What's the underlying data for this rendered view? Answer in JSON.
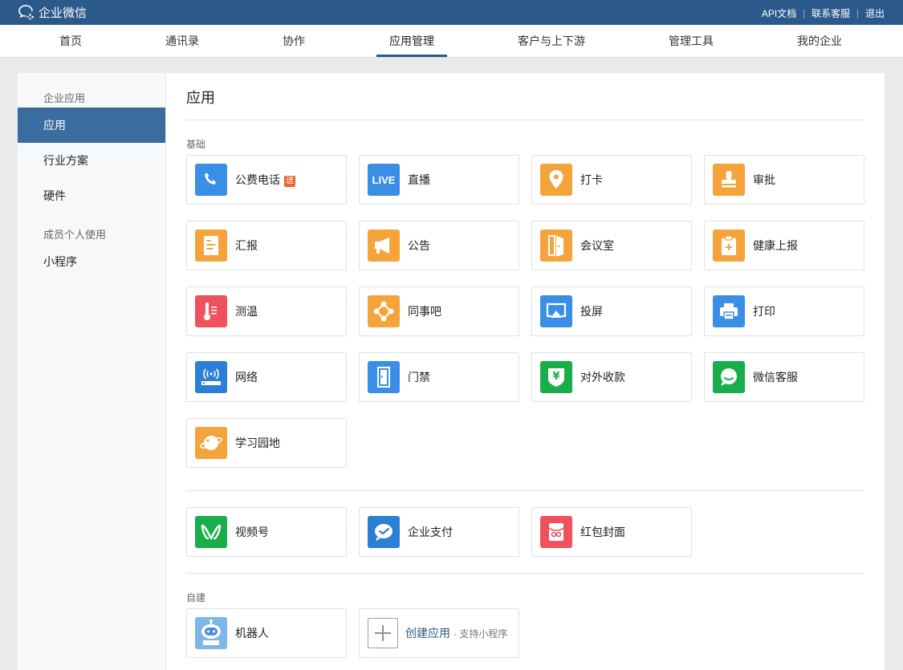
{
  "header": {
    "brand": "企业微信",
    "links": [
      "API文档",
      "联系客服",
      "退出"
    ]
  },
  "nav": {
    "items": [
      "首页",
      "通讯录",
      "协作",
      "应用管理",
      "客户与上下游",
      "管理工具",
      "我的企业"
    ],
    "active": "应用管理"
  },
  "sidebar": {
    "group1": "企业应用",
    "items1": [
      "应用",
      "行业方案",
      "硬件"
    ],
    "group2": "成员个人使用",
    "items2": [
      "小程序"
    ],
    "active": "应用"
  },
  "main": {
    "title": "应用",
    "basic_label": "基础",
    "send_badge": "送",
    "basic_apps": [
      {
        "name": "公费电话",
        "icon": "phone-icon",
        "color": "#3a8ee6"
      },
      {
        "name": "直播",
        "icon": "live-icon",
        "color": "#3a8ee6"
      },
      {
        "name": "打卡",
        "icon": "location-pin-icon",
        "color": "#f5a33b"
      },
      {
        "name": "审批",
        "icon": "stamp-icon",
        "color": "#f5a33b"
      },
      {
        "name": "汇报",
        "icon": "report-icon",
        "color": "#f5a33b"
      },
      {
        "name": "公告",
        "icon": "megaphone-icon",
        "color": "#f5a33b"
      },
      {
        "name": "会议室",
        "icon": "door-icon",
        "color": "#f5a33b"
      },
      {
        "name": "健康上报",
        "icon": "health-clipboard-icon",
        "color": "#f5a33b"
      },
      {
        "name": "测温",
        "icon": "thermometer-icon",
        "color": "#f0525d"
      },
      {
        "name": "同事吧",
        "icon": "community-icon",
        "color": "#f5a33b"
      },
      {
        "name": "投屏",
        "icon": "screencast-icon",
        "color": "#3a8ee6"
      },
      {
        "name": "打印",
        "icon": "printer-icon",
        "color": "#3a8ee6"
      },
      {
        "name": "网络",
        "icon": "router-icon",
        "color": "#2b7fd4"
      },
      {
        "name": "门禁",
        "icon": "access-door-icon",
        "color": "#3a8ee6"
      },
      {
        "name": "对外收款",
        "icon": "yuan-shield-icon",
        "color": "#1aad4b"
      },
      {
        "name": "微信客服",
        "icon": "chat-bubble-icon",
        "color": "#1aad4b"
      },
      {
        "name": "学习园地",
        "icon": "planet-icon",
        "color": "#f5a33b"
      }
    ],
    "extra_apps": [
      {
        "name": "视频号",
        "icon": "channels-icon",
        "color": "#1aad4b"
      },
      {
        "name": "企业支付",
        "icon": "payment-icon",
        "color": "#2b7fd4"
      },
      {
        "name": "红包封面",
        "icon": "red-envelope-icon",
        "color": "#f0525d"
      }
    ],
    "custom_label": "自建",
    "custom_apps": [
      {
        "name": "机器人",
        "icon": "robot-icon",
        "color": "#7fb6e8"
      }
    ],
    "create": {
      "label": "创建应用",
      "sub": "· 支持小程序"
    }
  }
}
